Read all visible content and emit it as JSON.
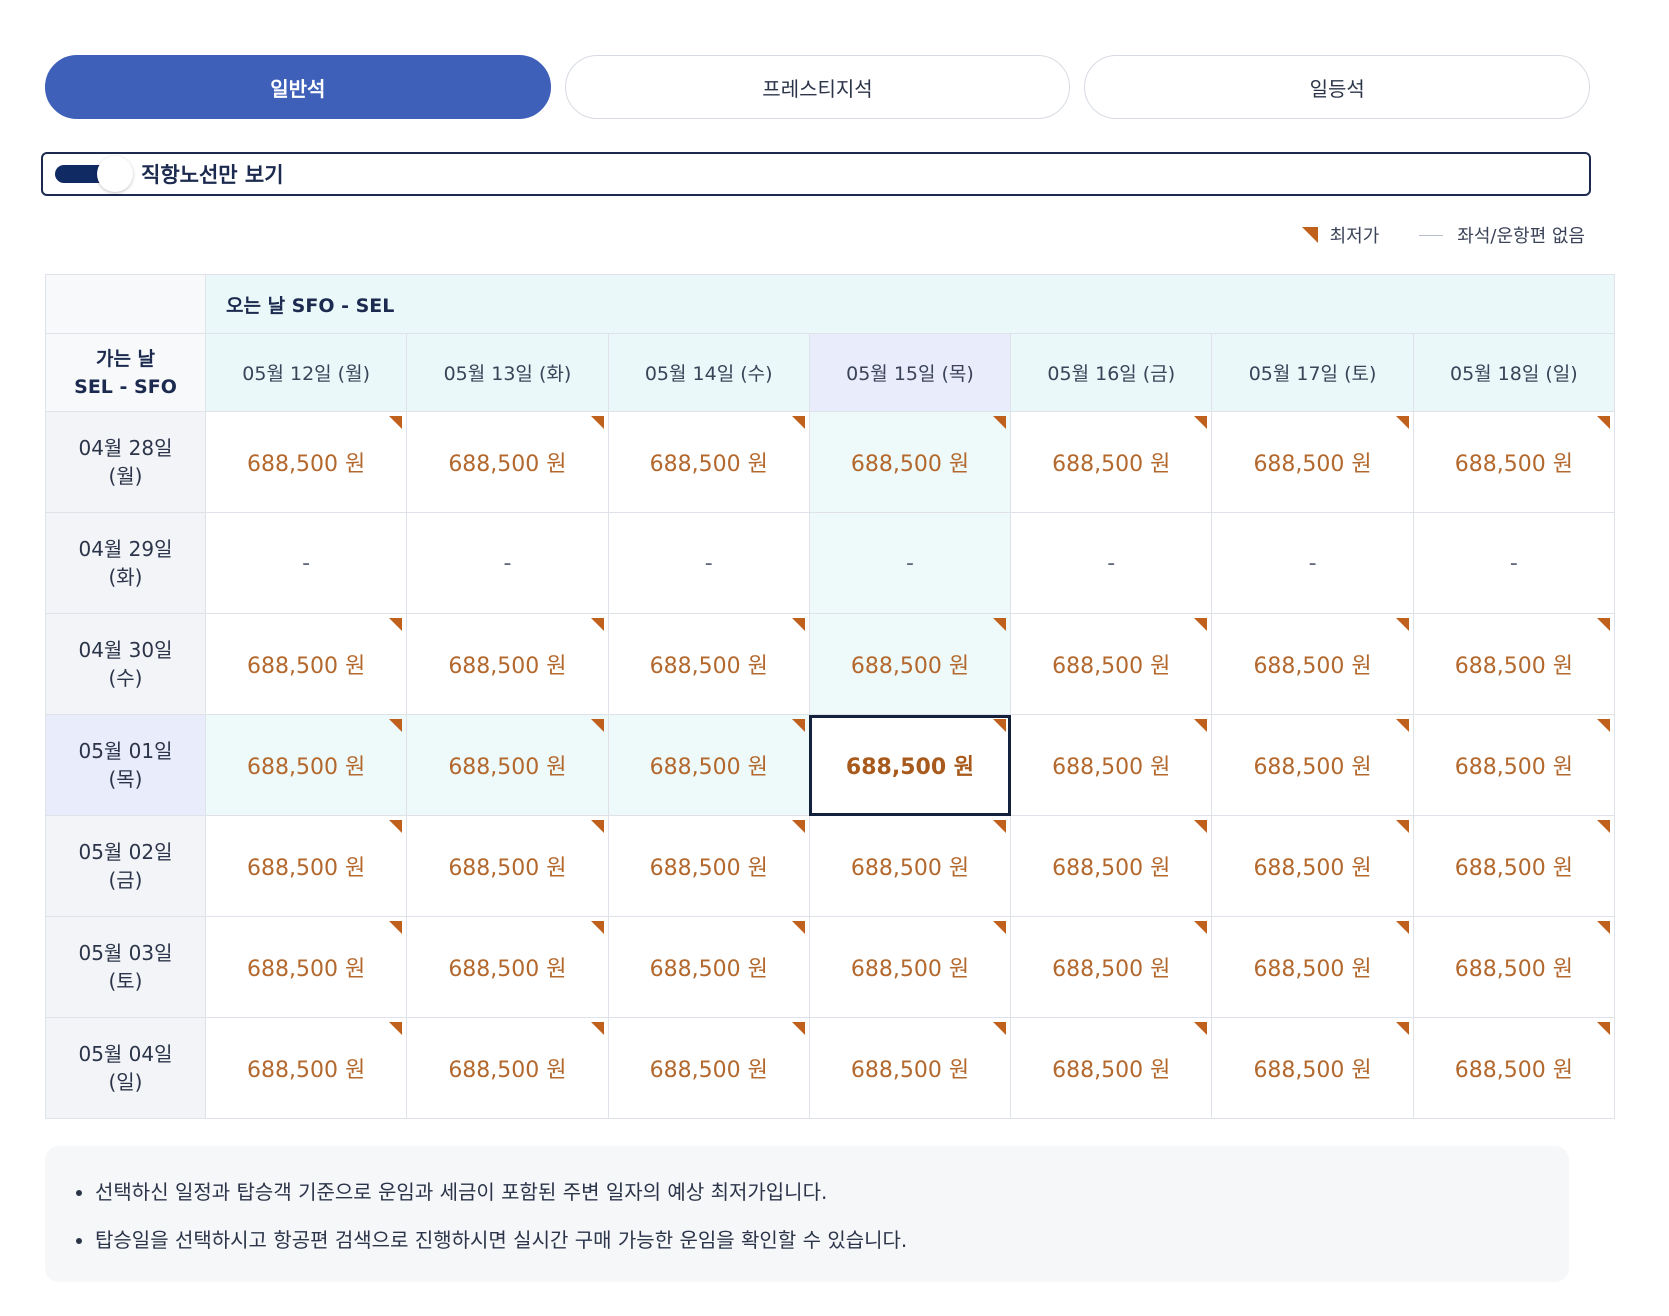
{
  "tabs": [
    {
      "label": "일반석",
      "active": true
    },
    {
      "label": "프레스티지석",
      "active": false
    },
    {
      "label": "일등석",
      "active": false
    }
  ],
  "toggle": {
    "label": "직항노선만 보기",
    "on": true
  },
  "legend": {
    "lowest": "최저가",
    "none": "좌석/운항편 없음"
  },
  "grid": {
    "return_header": "오는 날 SFO - SEL",
    "depart_header": [
      "가는 날",
      "SEL - SFO"
    ],
    "return_dates": [
      "05월 12일 (월)",
      "05월 13일 (화)",
      "05월 14일 (수)",
      "05월 15일 (목)",
      "05월 16일 (금)",
      "05월 17일 (토)",
      "05월 18일 (일)"
    ],
    "rows": [
      {
        "date": [
          "04월 28일",
          "(월)"
        ],
        "prices": [
          "688,500 원",
          "688,500 원",
          "688,500 원",
          "688,500 원",
          "688,500 원",
          "688,500 원",
          "688,500 원"
        ]
      },
      {
        "date": [
          "04월 29일",
          "(화)"
        ],
        "prices": [
          "-",
          "-",
          "-",
          "-",
          "-",
          "-",
          "-"
        ]
      },
      {
        "date": [
          "04월 30일",
          "(수)"
        ],
        "prices": [
          "688,500 원",
          "688,500 원",
          "688,500 원",
          "688,500 원",
          "688,500 원",
          "688,500 원",
          "688,500 원"
        ]
      },
      {
        "date": [
          "05월 01일",
          "(목)"
        ],
        "prices": [
          "688,500 원",
          "688,500 원",
          "688,500 원",
          "688,500 원",
          "688,500 원",
          "688,500 원",
          "688,500 원"
        ]
      },
      {
        "date": [
          "05월 02일",
          "(금)"
        ],
        "prices": [
          "688,500 원",
          "688,500 원",
          "688,500 원",
          "688,500 원",
          "688,500 원",
          "688,500 원",
          "688,500 원"
        ]
      },
      {
        "date": [
          "05월 03일",
          "(토)"
        ],
        "prices": [
          "688,500 원",
          "688,500 원",
          "688,500 원",
          "688,500 원",
          "688,500 원",
          "688,500 원",
          "688,500 원"
        ]
      },
      {
        "date": [
          "05월 04일",
          "(일)"
        ],
        "prices": [
          "688,500 원",
          "688,500 원",
          "688,500 원",
          "688,500 원",
          "688,500 원",
          "688,500 원",
          "688,500 원"
        ]
      }
    ],
    "selected": {
      "row": 3,
      "col": 3
    }
  },
  "notes": [
    "선택하신 일정과 탑승객 기준으로 운임과 세금이 포함된 주변 일자의 예상 최저가입니다.",
    "탑승일을 선택하시고 항공편 검색으로 진행하시면 실시간 구매 가능한 운임을 확인할 수 있습니다."
  ],
  "colors": {
    "accent": "#3e60b9",
    "price": "#b3682e",
    "lowest_marker": "#c0601d",
    "navy": "#102a63"
  }
}
